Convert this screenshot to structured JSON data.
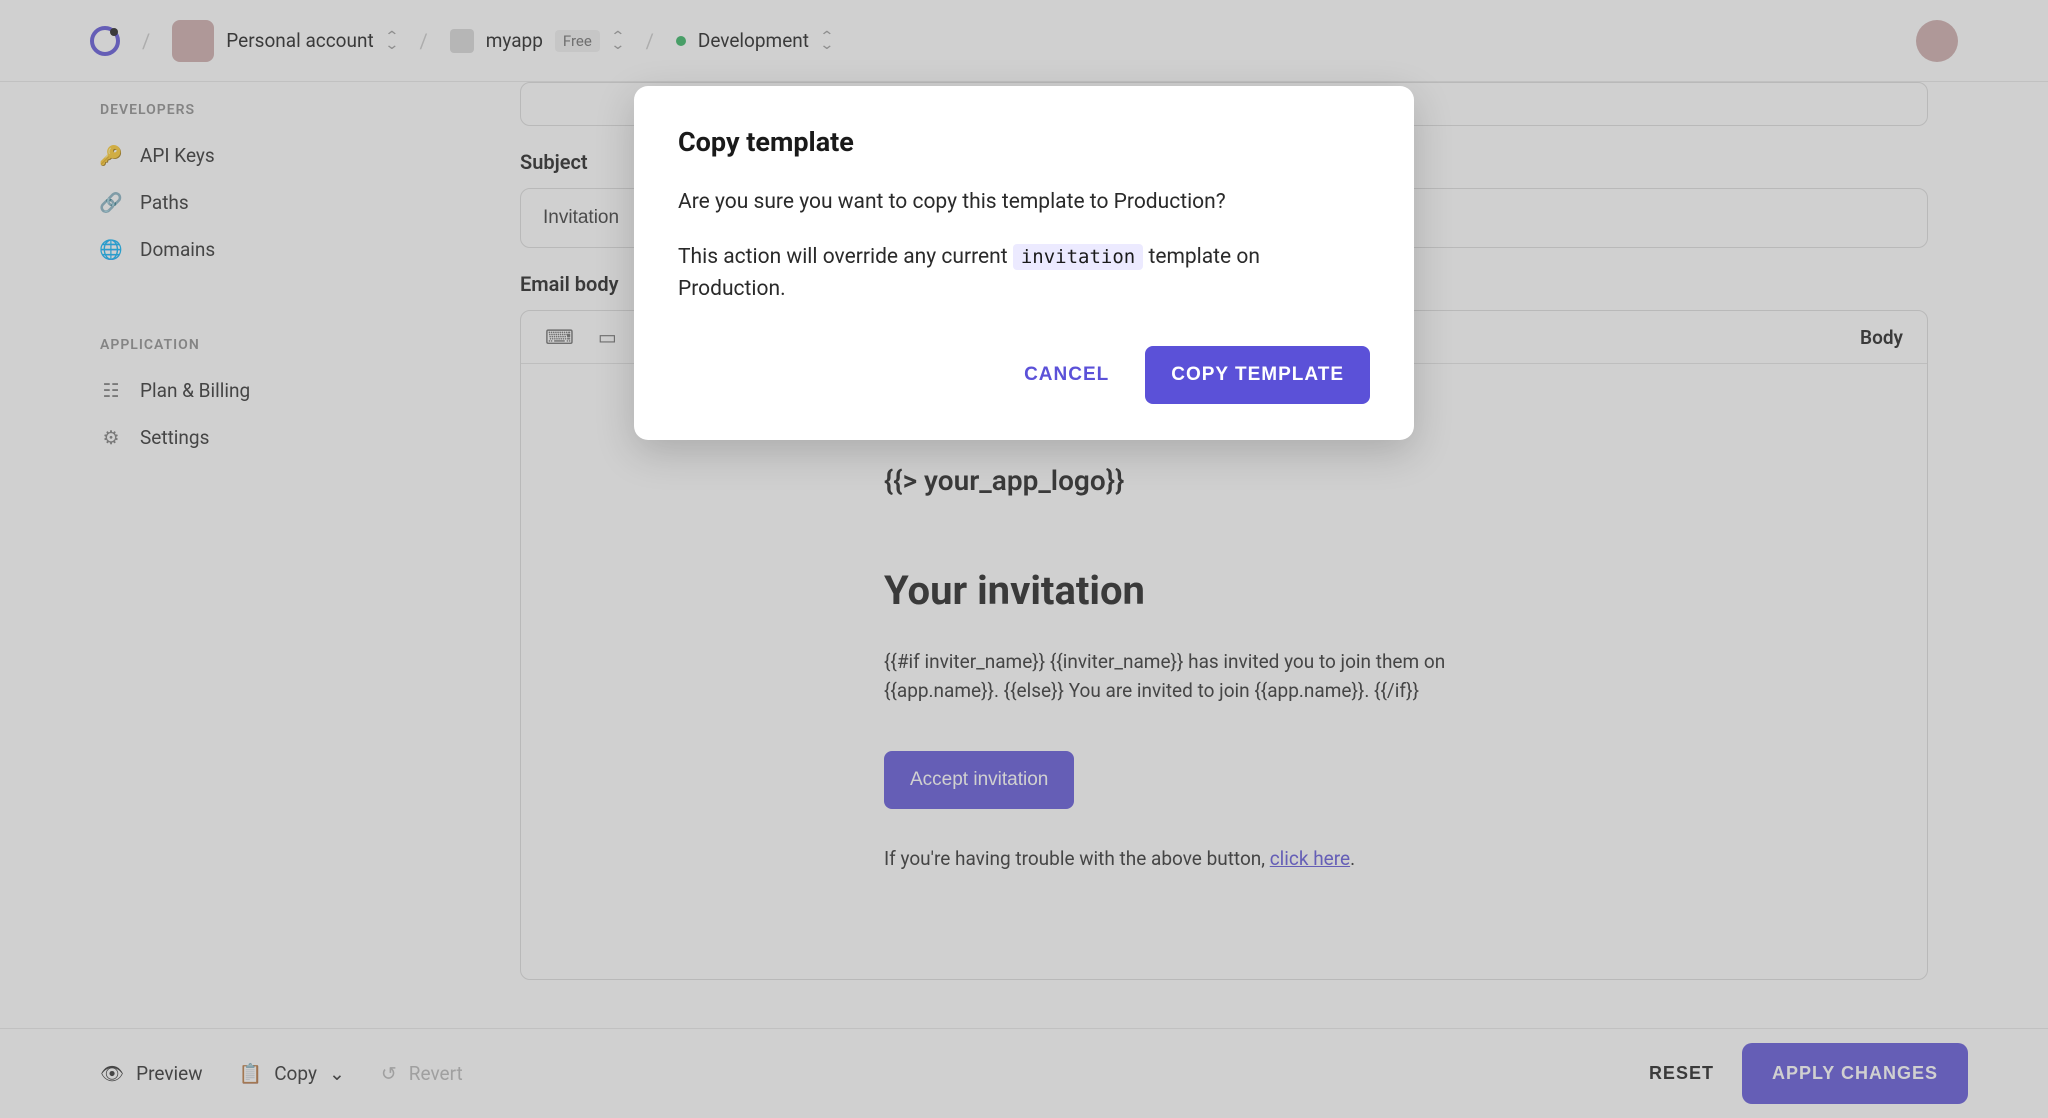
{
  "breadcrumb": {
    "account": "Personal account",
    "app_name": "myapp",
    "app_plan": "Free",
    "environment": "Development"
  },
  "sidebar": {
    "group1_label": "DEVELOPERS",
    "item_api_keys": "API Keys",
    "item_paths": "Paths",
    "item_domains": "Domains",
    "group2_label": "APPLICATION",
    "item_plan_billing": "Plan & Billing",
    "item_settings": "Settings"
  },
  "form": {
    "subject_label": "Subject",
    "subject_value": "Invitation",
    "email_body_label": "Email body",
    "toolbar_body": "Body"
  },
  "email_preview": {
    "logo_placeholder": "{{> your_app_logo}}",
    "title": "Your invitation",
    "paragraph": "{{#if inviter_name}} {{inviter_name}} has invited you to join them on {{app.name}}. {{else}} You are invited to join {{app.name}}. {{/if}}",
    "cta": "Accept invitation",
    "trouble_prefix": "If you're having trouble with the above button, ",
    "trouble_link": "click here",
    "trouble_suffix": "."
  },
  "bottombar": {
    "preview": "Preview",
    "copy": "Copy",
    "revert": "Revert",
    "reset": "RESET",
    "apply": "APPLY CHANGES"
  },
  "modal": {
    "title": "Copy template",
    "line1": "Are you sure you want to copy this template to Production?",
    "line2_pre": "This action will override any current ",
    "line2_code": "invitation",
    "line2_post": " template on Production.",
    "cancel": "CANCEL",
    "confirm": "COPY TEMPLATE"
  }
}
